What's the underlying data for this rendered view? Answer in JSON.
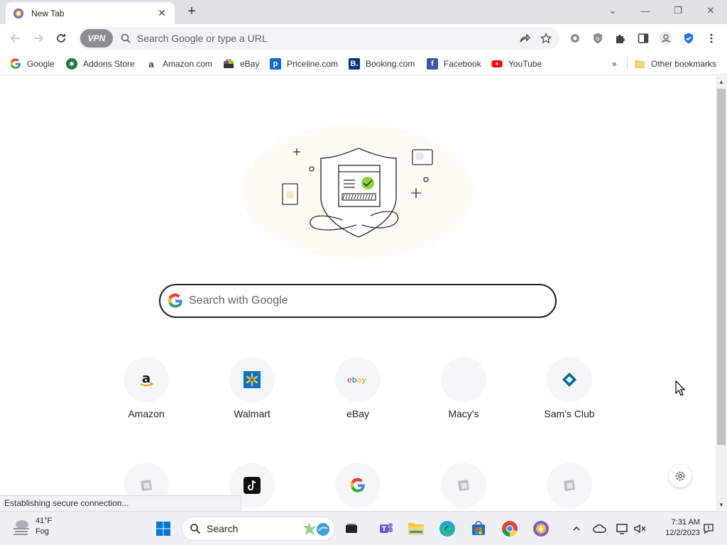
{
  "window": {
    "tab_title": "New Tab"
  },
  "toolbar": {
    "vpn_label": "VPN",
    "omnibox_placeholder": "Search Google or type a URL"
  },
  "bookmarks": [
    {
      "label": "Google",
      "icon": "google-icon"
    },
    {
      "label": "Addons Store",
      "icon": "addons-store-icon"
    },
    {
      "label": "Amazon.com",
      "icon": "amazon-icon"
    },
    {
      "label": "eBay",
      "icon": "ebay-icon"
    },
    {
      "label": "Priceline.com",
      "icon": "priceline-icon"
    },
    {
      "label": "Booking.com",
      "icon": "booking-icon"
    },
    {
      "label": "Facebook",
      "icon": "facebook-icon"
    },
    {
      "label": "YouTube",
      "icon": "youtube-icon"
    }
  ],
  "other_bookmarks": "Other bookmarks",
  "search": {
    "placeholder": "Search with Google"
  },
  "shortcuts": [
    {
      "label": "Amazon",
      "icon": "amazon-icon"
    },
    {
      "label": "Walmart",
      "icon": "walmart-icon"
    },
    {
      "label": "eBay",
      "icon": "ebay-icon"
    },
    {
      "label": "Macy's",
      "icon": "macys-icon"
    },
    {
      "label": "Sam's Club",
      "icon": "sams-club-icon"
    }
  ],
  "shortcuts_row2": [
    {
      "icon": "generic-site-icon"
    },
    {
      "icon": "tiktok-icon"
    },
    {
      "icon": "google-icon"
    },
    {
      "icon": "generic-site-icon"
    },
    {
      "icon": "generic-site-icon"
    }
  ],
  "status_bar": "Establishing secure connection...",
  "taskbar": {
    "weather_temp": "41°F",
    "weather_desc": "Fog",
    "search_label": "Search",
    "time": "7:31 AM",
    "date": "12/2/2023"
  },
  "colors": {
    "tabstrip": "#dee1e6",
    "omnibox": "#f1f3f4",
    "accent_green": "#3ab54a",
    "youtube_red": "#ff0000",
    "facebook_blue": "#1877f2"
  }
}
